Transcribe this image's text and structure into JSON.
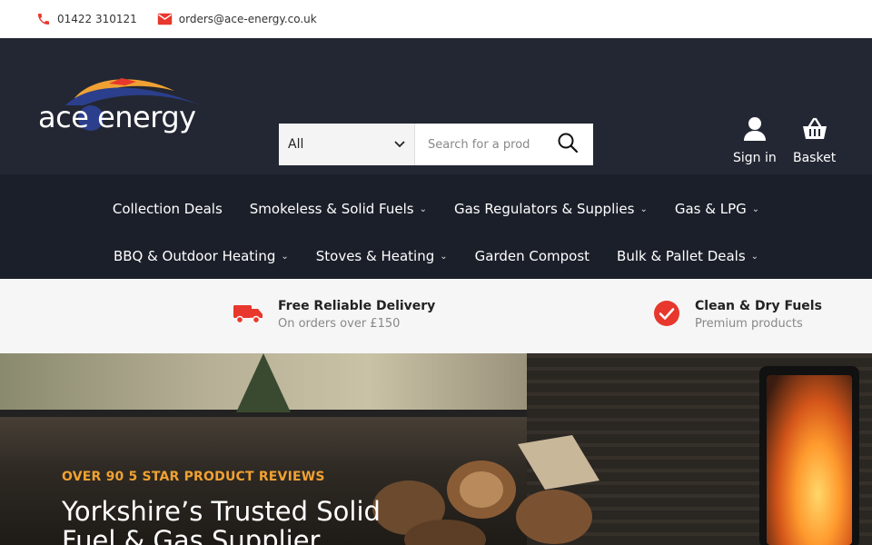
{
  "topbar": {
    "phone": "01422 310121",
    "email": "orders@ace-energy.co.uk"
  },
  "brand": {
    "logo_text": "ace energy",
    "accent": "#e8372c",
    "header_bg": "#232733",
    "nav_bg": "#1b1f2a"
  },
  "search": {
    "category_selected": "All",
    "placeholder": "Search for a product"
  },
  "account": {
    "signin_label": "Sign in",
    "basket_label": "Basket"
  },
  "nav": {
    "row1": [
      {
        "label": "Collection Deals",
        "dropdown": false
      },
      {
        "label": "Smokeless & Solid Fuels",
        "dropdown": true
      },
      {
        "label": "Gas Regulators & Supplies",
        "dropdown": true
      },
      {
        "label": "Gas & LPG",
        "dropdown": true
      }
    ],
    "row2": [
      {
        "label": "BBQ & Outdoor Heating",
        "dropdown": true
      },
      {
        "label": "Stoves & Heating",
        "dropdown": true
      },
      {
        "label": "Garden Compost",
        "dropdown": false
      },
      {
        "label": "Bulk & Pallet Deals",
        "dropdown": true
      }
    ]
  },
  "benefits": [
    {
      "title": "Free Reliable Delivery",
      "subtitle": "On orders over £150",
      "icon": "truck-icon"
    },
    {
      "title": "Clean & Dry Fuels",
      "subtitle": "Premium products",
      "icon": "check-circle-icon"
    }
  ],
  "hero": {
    "eyebrow": "OVER 90 5 STAR PRODUCT REVIEWS",
    "title": "Yorkshire’s Trusted Solid Fuel & Gas Supplier"
  }
}
